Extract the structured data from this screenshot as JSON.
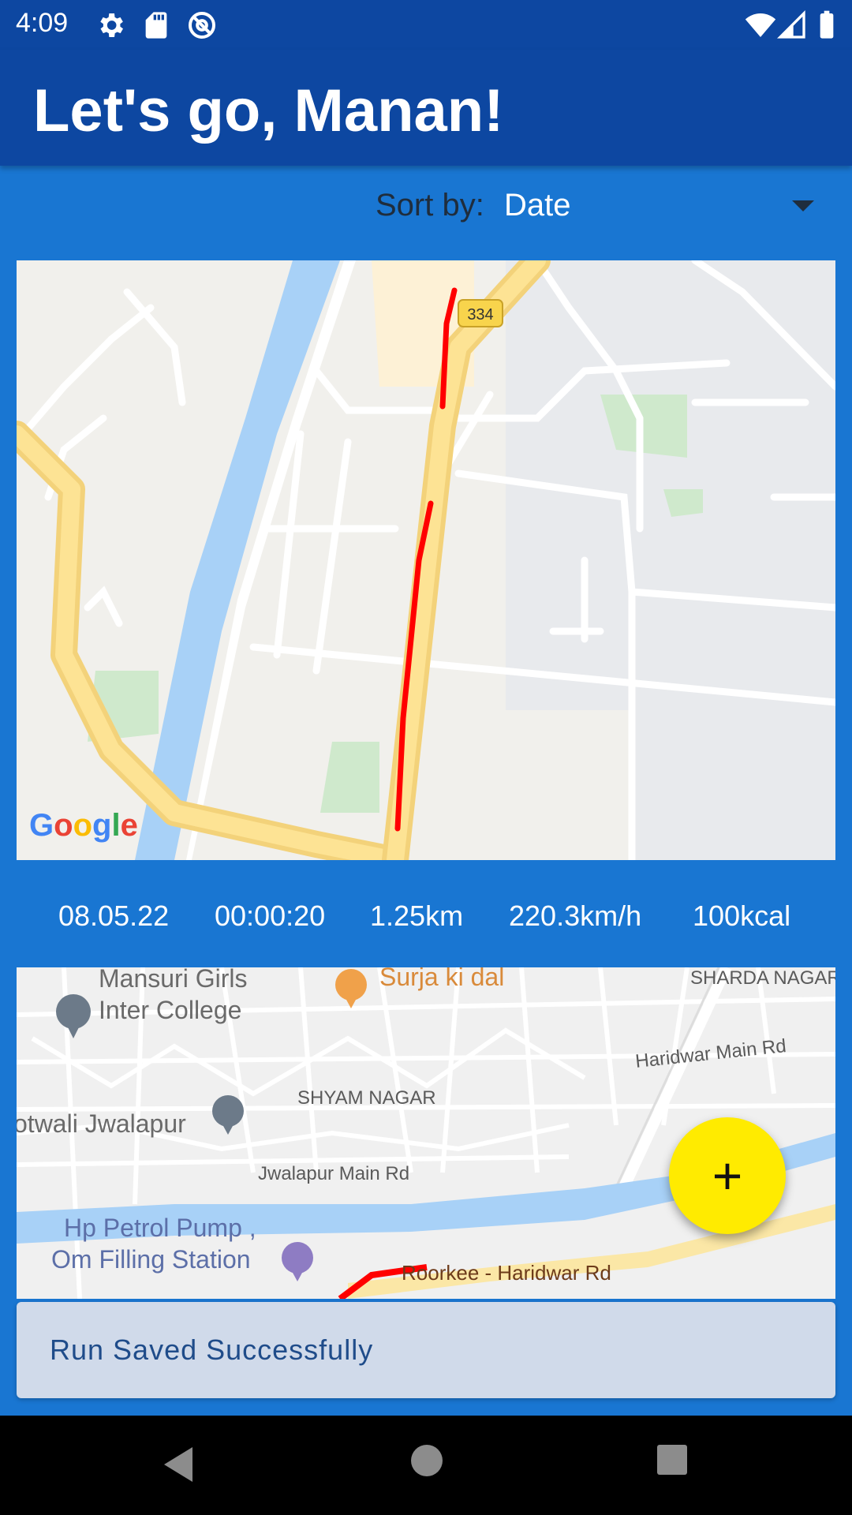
{
  "status_bar": {
    "time": "4:09",
    "left_icons": [
      "gear-icon",
      "sd-card-icon",
      "location-off-icon"
    ],
    "right_icons": [
      "wifi-icon",
      "signal-icon",
      "battery-icon"
    ]
  },
  "app_bar": {
    "title": "Let's go, Manan!"
  },
  "sort": {
    "label": "Sort by:",
    "value": "Date"
  },
  "runs": [
    {
      "date": "08.05.22",
      "duration": "00:00:20",
      "distance": "1.25km",
      "speed": "220.3km/h",
      "calories": "100kcal",
      "map_road_badge": "334",
      "map_logo": "Google"
    }
  ],
  "map2_labels": {
    "college": "Mansuri Girls\nInter College",
    "restaurant": "Surja ki dal",
    "sharda": "SHARDA NAGAR",
    "haridwar_main": "Haridwar Main Rd",
    "shyam": "SHYAM NAGAR",
    "kotwali": "otwali Jwalapur",
    "jwalapur_main": "Jwalapur Main Rd",
    "petrol1": "Hp Petrol Pump ,",
    "petrol2": "Om Filling Station",
    "roorkee": "Roorkee - Haridwar Rd"
  },
  "fab": {
    "label": "+"
  },
  "snackbar": {
    "message": "Run Saved Successfully"
  },
  "colors": {
    "primary_dark": "#0d47a1",
    "primary": "#1976d2",
    "accent": "#ffeb00",
    "route": "#ff0000"
  }
}
